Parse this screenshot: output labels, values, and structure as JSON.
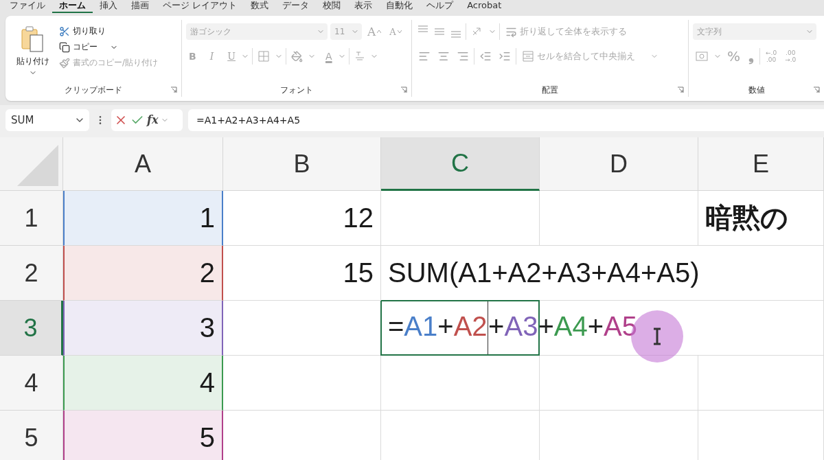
{
  "menu_tabs": [
    {
      "label": "ファイル",
      "selected": false
    },
    {
      "label": "ホーム",
      "selected": true
    },
    {
      "label": "挿入",
      "selected": false
    },
    {
      "label": "描画",
      "selected": false
    },
    {
      "label": "ページ レイアウト",
      "selected": false
    },
    {
      "label": "数式",
      "selected": false
    },
    {
      "label": "データ",
      "selected": false
    },
    {
      "label": "校閲",
      "selected": false
    },
    {
      "label": "表示",
      "selected": false
    },
    {
      "label": "自動化",
      "selected": false
    },
    {
      "label": "ヘルプ",
      "selected": false
    },
    {
      "label": "Acrobat",
      "selected": false
    }
  ],
  "ribbon": {
    "clipboard": {
      "label": "クリップボード",
      "paste": "貼り付け",
      "cut": "切り取り",
      "copy": "コピー",
      "format_painter": "書式のコピー/貼り付け",
      "format_painter_disabled": true
    },
    "font": {
      "label": "フォント",
      "disabled": true,
      "font_name": "游ゴシック",
      "font_size": "11",
      "grow": "A",
      "shrink": "A",
      "bold": "B",
      "italic": "I",
      "underline": "U",
      "font_color": "A"
    },
    "alignment": {
      "label": "配置",
      "disabled": true,
      "wrap_text": "折り返して全体を表示する",
      "merge": "セルを結合して中央揃え"
    },
    "number": {
      "label": "数値",
      "disabled": true,
      "format": "文字列",
      "percent": "%",
      "comma": "❟",
      "decimals": [
        {
          "top": "←.0",
          "bottom": ".00"
        },
        {
          "top": ".00",
          "bottom": "→.0"
        }
      ]
    }
  },
  "formula_bar": {
    "name_box": "SUM",
    "fx": "fx",
    "formula": "=A1+A2+A3+A4+A5"
  },
  "sheet": {
    "columns": [
      {
        "label": "A",
        "selected": false
      },
      {
        "label": "B",
        "selected": false
      },
      {
        "label": "C",
        "selected": true
      },
      {
        "label": "D",
        "selected": false
      },
      {
        "label": "E",
        "selected": false
      }
    ],
    "rows": [
      {
        "label": "1",
        "selected": false,
        "cells": [
          {
            "kind": "number",
            "value": "1",
            "color": "#4a7fc9",
            "selected": false
          },
          {
            "kind": "number",
            "value": "12",
            "selected": false
          },
          {
            "kind": "empty",
            "selected": false
          },
          {
            "kind": "empty",
            "selected": false
          },
          {
            "kind": "text",
            "value": "暗黙の",
            "bold": true,
            "selected": false
          }
        ]
      },
      {
        "label": "2",
        "selected": false,
        "cells": [
          {
            "kind": "number",
            "value": "2",
            "color": "#c0504d",
            "selected": false
          },
          {
            "kind": "number",
            "value": "15",
            "selected": false
          },
          {
            "kind": "text",
            "value": "SUM(A1+A2+A3+A4+A5)",
            "bold": false,
            "selected": false
          }
        ]
      },
      {
        "label": "3",
        "selected": true,
        "cells": [
          {
            "kind": "number",
            "value": "3",
            "color": "#8064b8",
            "selected": false
          },
          {
            "kind": "empty",
            "selected": false
          },
          {
            "kind": "editing",
            "selected": true,
            "tokens": [
              {
                "text": "=",
                "color": "#222222",
                "caret": false
              },
              {
                "text": "A1",
                "color": "#4a7fc9",
                "caret": false
              },
              {
                "text": "+",
                "color": "#222222",
                "caret": false
              },
              {
                "text": "A2",
                "color": "#c0504d",
                "caret": true
              },
              {
                "text": "+",
                "color": "#222222",
                "caret": false
              },
              {
                "text": "A3",
                "color": "#8064b8",
                "caret": false
              },
              {
                "text": "+",
                "color": "#222222",
                "caret": false
              },
              {
                "text": "A4",
                "color": "#3c9a50",
                "caret": false
              },
              {
                "text": "+",
                "color": "#222222",
                "caret": false
              },
              {
                "text": "A5",
                "color": "#b0408a",
                "caret": false
              }
            ]
          }
        ]
      },
      {
        "label": "4",
        "selected": false,
        "cells": [
          {
            "kind": "number",
            "value": "4",
            "color": "#3c9a50",
            "selected": false
          },
          {
            "kind": "empty",
            "selected": false
          },
          {
            "kind": "empty",
            "selected": false
          },
          {
            "kind": "empty",
            "selected": false
          },
          {
            "kind": "empty",
            "selected": false
          }
        ]
      },
      {
        "label": "5",
        "selected": false,
        "cells": [
          {
            "kind": "number",
            "value": "5",
            "color": "#b0408a",
            "selected": false
          },
          {
            "kind": "empty",
            "selected": false
          },
          {
            "kind": "empty",
            "selected": false
          },
          {
            "kind": "empty",
            "selected": false
          },
          {
            "kind": "empty",
            "selected": false
          }
        ]
      }
    ]
  }
}
